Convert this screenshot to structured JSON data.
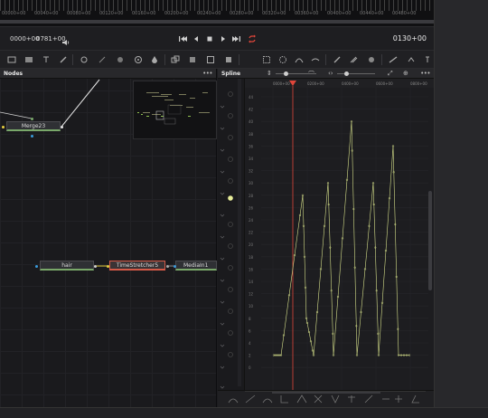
{
  "ruler": {
    "labels": [
      "00000+00",
      "00040+00",
      "00080+00",
      "00120+00",
      "00160+00",
      "00200+00",
      "00240+00",
      "00280+00",
      "00320+00",
      "00360+00",
      "00400+00",
      "00440+00",
      "00480+00"
    ]
  },
  "transport": {
    "timecode_in": "0000+00",
    "timecode_out": "0781+00",
    "current_timecode": "0130+00",
    "buttons": [
      "skip-to-start",
      "step-back",
      "stop",
      "play",
      "skip-to-end",
      "loop"
    ],
    "loop_color": "#e0463a"
  },
  "toolbar": {
    "icons": [
      "viewer-icon",
      "clip-icon",
      "text-icon",
      "paint-icon",
      "background-icon",
      "brush-icon",
      "blur-icon",
      "color-corrector-icon",
      "drop-icon",
      "merge-icon",
      "layer-icon",
      "transform-icon",
      "rectangle-icon",
      "ellipse-icon",
      "polygon-icon",
      "bspline-icon",
      "pen-icon",
      "tracker-icon",
      "particle-icon",
      "keyer-icon",
      "shape-icon",
      "more-icon"
    ]
  },
  "nodes_panel": {
    "title": "Nodes",
    "menu_label": "•••",
    "nodes": [
      {
        "label": "Merge23"
      },
      {
        "label": "hair"
      },
      {
        "label": "TimeStretcher5"
      },
      {
        "label": "MediaIn1"
      }
    ]
  },
  "spline_panel": {
    "title": "Spline",
    "menu_label": "•••",
    "time_labels": [
      "0000+00",
      "0200+00",
      "0400+00",
      "0600+00",
      "0800+00"
    ],
    "y_labels": [
      "44",
      "42",
      "40",
      "38",
      "36",
      "34",
      "32",
      "30",
      "28",
      "26",
      "24",
      "22",
      "20",
      "18",
      "16",
      "14",
      "12",
      "10",
      "8",
      "6",
      "4",
      "2",
      "0"
    ]
  },
  "colors": {
    "accent": "#e0463a",
    "curve": "#d6e08a",
    "node_edge": "#79a86a",
    "selected_node": "#d45a48"
  }
}
